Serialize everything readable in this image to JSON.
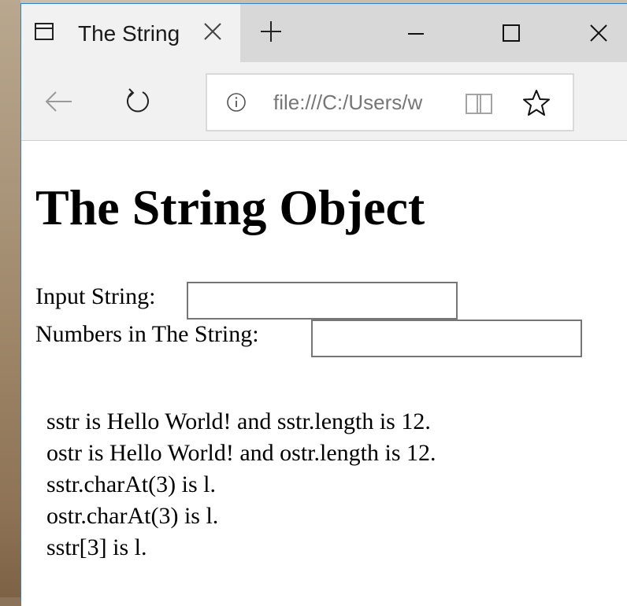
{
  "browser": {
    "tab_title": "The String",
    "address_url": "file:///C:/Users/w"
  },
  "page": {
    "heading": "The String Object",
    "input_label": "Input String:",
    "input_value": "",
    "numbers_label": "Numbers in The String:",
    "numbers_value": "",
    "output_lines": [
      "sstr is Hello World! and sstr.length is 12.",
      "ostr is Hello World! and ostr.length is 12.",
      "sstr.charAt(3) is l.",
      "ostr.charAt(3) is l.",
      "sstr[3] is l."
    ]
  },
  "icons": {
    "tab": "tab-page-icon",
    "tab_close": "close-icon",
    "new_tab": "plus-icon",
    "minimize": "minimize-icon",
    "maximize": "maximize-icon",
    "close": "close-icon",
    "back": "back-arrow-icon",
    "refresh": "refresh-icon",
    "info": "info-icon",
    "reading_view": "book-icon",
    "favorite": "star-icon"
  }
}
